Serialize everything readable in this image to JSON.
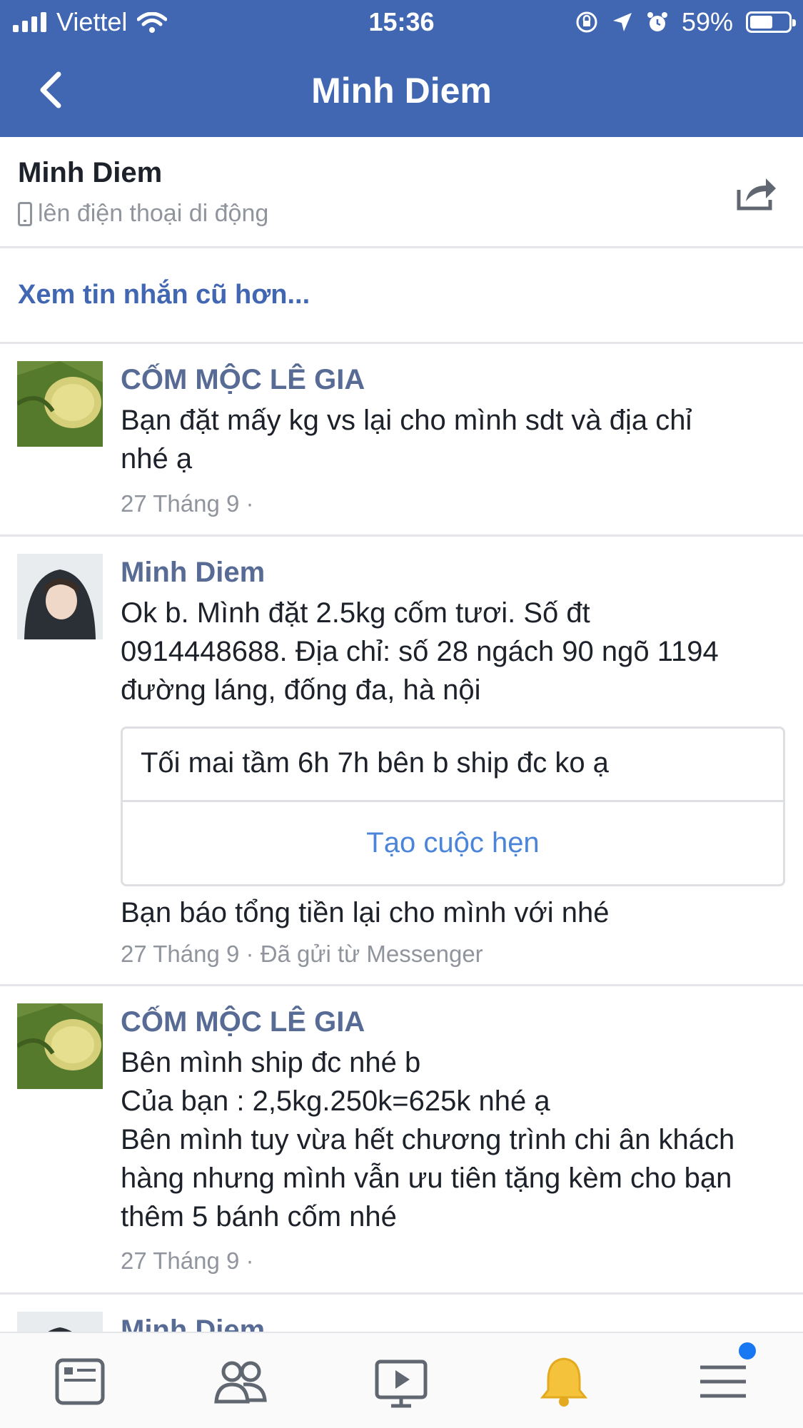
{
  "status_bar": {
    "carrier": "Viettel",
    "time": "15:36",
    "battery_percent": "59%",
    "battery_level": 0.59
  },
  "nav": {
    "title": "Minh Diem",
    "back_icon": "chevron-left-icon"
  },
  "profile": {
    "name": "Minh Diem",
    "subtitle": "lên điện thoại di động",
    "share_icon": "share-icon"
  },
  "older_link": "Xem tin nhắn cũ hơn...",
  "messages": [
    {
      "sender": "CỐM MỘC LÊ GIA",
      "lines": [
        "Bạn đặt mấy kg vs lại cho mình sdt và địa chỉ",
        "nhé ạ"
      ],
      "meta": "27 Tháng 9 ·"
    },
    {
      "sender": "Minh Diem",
      "lines": [
        "Ok b. Mình đặt 2.5kg cốm tươi. Số đt",
        "0914448688. Địa chỉ: số 28 ngách 90 ngõ 1194",
        "đường láng, đống đa, hà nội"
      ],
      "card_question": "Tối mai tầm 6h 7h bên b ship đc ko ạ",
      "card_action": "Tạo cuộc hẹn",
      "after_card": "Bạn báo tổng tiền lại cho mình với nhé",
      "meta": "27 Tháng 9 · Đã gửi từ Messenger"
    },
    {
      "sender": "CỐM MỘC LÊ GIA",
      "lines": [
        "Bên mình ship đc nhé b",
        "Của bạn : 2,5kg.250k=625k nhé ạ",
        "Bên mình tuy vừa hết chương trình chi ân khách",
        "hàng nhưng mình vẫn ưu tiên tặng kèm cho bạn",
        "thêm 5 bánh cốm nhé"
      ],
      "meta": "27 Tháng 9 ·"
    },
    {
      "sender": "Minh Diem"
    }
  ],
  "tabs": [
    "news-feed-icon",
    "friends-icon",
    "video-icon",
    "notifications-bell-icon",
    "menu-icon"
  ],
  "colors": {
    "header_blue": "#4267b2",
    "sender_blue": "#576b95",
    "link_blue": "#4267b2",
    "cta_blue": "#4a85d9",
    "meta_gray": "#90949c",
    "bell_yellow": "#f5c33b",
    "badge_blue": "#1877f2"
  }
}
